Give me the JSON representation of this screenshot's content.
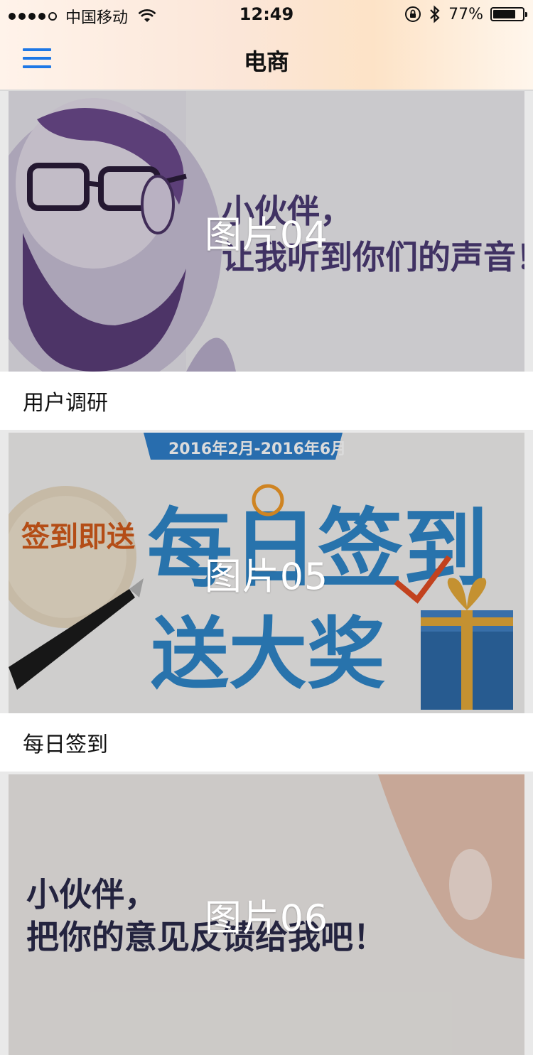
{
  "status_bar": {
    "carrier": "中国移动",
    "time": "12:49",
    "battery_percent": "77%",
    "battery_level": 0.77
  },
  "navbar": {
    "title": "电商"
  },
  "feed": {
    "cards": [
      {
        "image_caption": "图片04",
        "title": "用户调研"
      },
      {
        "image_caption": "图片05",
        "title": "每日签到"
      },
      {
        "image_caption": "图片06",
        "title": ""
      }
    ],
    "image_texts": {
      "card04_headline_1": "小伙伴，",
      "card04_headline_2": "让我听到你们的声音！",
      "card05_date_banner": "2016年2月-2016年6月",
      "card05_badge": "签到即送",
      "card05_big_1": "每日签到",
      "card05_big_2": "送大奖",
      "card06_headline_1": "小伙伴，",
      "card06_headline_2": "把你的意见反馈给我吧！"
    }
  },
  "colors": {
    "accent": "#1e78e6",
    "page_bg": "#e9e9e9"
  }
}
